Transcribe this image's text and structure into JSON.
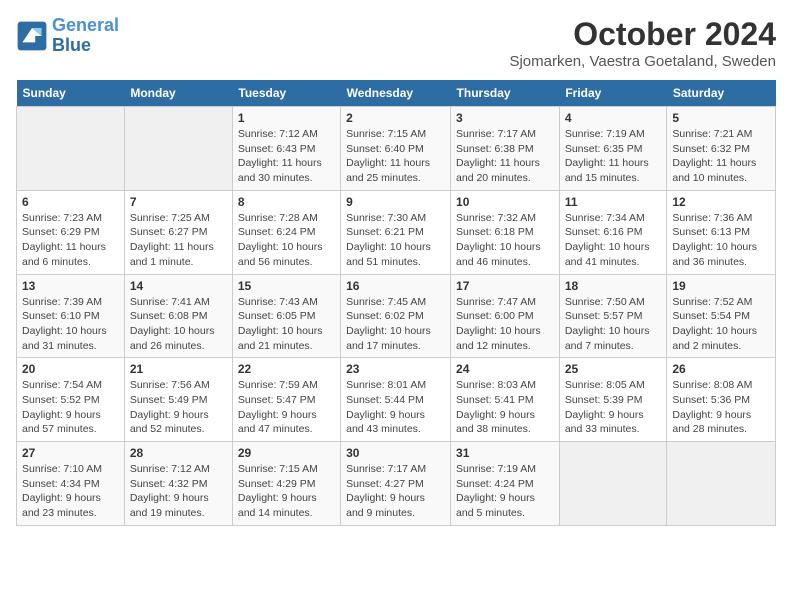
{
  "header": {
    "logo_text_general": "General",
    "logo_text_blue": "Blue",
    "title": "October 2024",
    "subtitle": "Sjomarken, Vaestra Goetaland, Sweden"
  },
  "weekdays": [
    "Sunday",
    "Monday",
    "Tuesday",
    "Wednesday",
    "Thursday",
    "Friday",
    "Saturday"
  ],
  "weeks": [
    [
      {
        "day": "",
        "info": ""
      },
      {
        "day": "",
        "info": ""
      },
      {
        "day": "1",
        "info": "Sunrise: 7:12 AM\nSunset: 6:43 PM\nDaylight: 11 hours\nand 30 minutes."
      },
      {
        "day": "2",
        "info": "Sunrise: 7:15 AM\nSunset: 6:40 PM\nDaylight: 11 hours\nand 25 minutes."
      },
      {
        "day": "3",
        "info": "Sunrise: 7:17 AM\nSunset: 6:38 PM\nDaylight: 11 hours\nand 20 minutes."
      },
      {
        "day": "4",
        "info": "Sunrise: 7:19 AM\nSunset: 6:35 PM\nDaylight: 11 hours\nand 15 minutes."
      },
      {
        "day": "5",
        "info": "Sunrise: 7:21 AM\nSunset: 6:32 PM\nDaylight: 11 hours\nand 10 minutes."
      }
    ],
    [
      {
        "day": "6",
        "info": "Sunrise: 7:23 AM\nSunset: 6:29 PM\nDaylight: 11 hours\nand 6 minutes."
      },
      {
        "day": "7",
        "info": "Sunrise: 7:25 AM\nSunset: 6:27 PM\nDaylight: 11 hours\nand 1 minute."
      },
      {
        "day": "8",
        "info": "Sunrise: 7:28 AM\nSunset: 6:24 PM\nDaylight: 10 hours\nand 56 minutes."
      },
      {
        "day": "9",
        "info": "Sunrise: 7:30 AM\nSunset: 6:21 PM\nDaylight: 10 hours\nand 51 minutes."
      },
      {
        "day": "10",
        "info": "Sunrise: 7:32 AM\nSunset: 6:18 PM\nDaylight: 10 hours\nand 46 minutes."
      },
      {
        "day": "11",
        "info": "Sunrise: 7:34 AM\nSunset: 6:16 PM\nDaylight: 10 hours\nand 41 minutes."
      },
      {
        "day": "12",
        "info": "Sunrise: 7:36 AM\nSunset: 6:13 PM\nDaylight: 10 hours\nand 36 minutes."
      }
    ],
    [
      {
        "day": "13",
        "info": "Sunrise: 7:39 AM\nSunset: 6:10 PM\nDaylight: 10 hours\nand 31 minutes."
      },
      {
        "day": "14",
        "info": "Sunrise: 7:41 AM\nSunset: 6:08 PM\nDaylight: 10 hours\nand 26 minutes."
      },
      {
        "day": "15",
        "info": "Sunrise: 7:43 AM\nSunset: 6:05 PM\nDaylight: 10 hours\nand 21 minutes."
      },
      {
        "day": "16",
        "info": "Sunrise: 7:45 AM\nSunset: 6:02 PM\nDaylight: 10 hours\nand 17 minutes."
      },
      {
        "day": "17",
        "info": "Sunrise: 7:47 AM\nSunset: 6:00 PM\nDaylight: 10 hours\nand 12 minutes."
      },
      {
        "day": "18",
        "info": "Sunrise: 7:50 AM\nSunset: 5:57 PM\nDaylight: 10 hours\nand 7 minutes."
      },
      {
        "day": "19",
        "info": "Sunrise: 7:52 AM\nSunset: 5:54 PM\nDaylight: 10 hours\nand 2 minutes."
      }
    ],
    [
      {
        "day": "20",
        "info": "Sunrise: 7:54 AM\nSunset: 5:52 PM\nDaylight: 9 hours\nand 57 minutes."
      },
      {
        "day": "21",
        "info": "Sunrise: 7:56 AM\nSunset: 5:49 PM\nDaylight: 9 hours\nand 52 minutes."
      },
      {
        "day": "22",
        "info": "Sunrise: 7:59 AM\nSunset: 5:47 PM\nDaylight: 9 hours\nand 47 minutes."
      },
      {
        "day": "23",
        "info": "Sunrise: 8:01 AM\nSunset: 5:44 PM\nDaylight: 9 hours\nand 43 minutes."
      },
      {
        "day": "24",
        "info": "Sunrise: 8:03 AM\nSunset: 5:41 PM\nDaylight: 9 hours\nand 38 minutes."
      },
      {
        "day": "25",
        "info": "Sunrise: 8:05 AM\nSunset: 5:39 PM\nDaylight: 9 hours\nand 33 minutes."
      },
      {
        "day": "26",
        "info": "Sunrise: 8:08 AM\nSunset: 5:36 PM\nDaylight: 9 hours\nand 28 minutes."
      }
    ],
    [
      {
        "day": "27",
        "info": "Sunrise: 7:10 AM\nSunset: 4:34 PM\nDaylight: 9 hours\nand 23 minutes."
      },
      {
        "day": "28",
        "info": "Sunrise: 7:12 AM\nSunset: 4:32 PM\nDaylight: 9 hours\nand 19 minutes."
      },
      {
        "day": "29",
        "info": "Sunrise: 7:15 AM\nSunset: 4:29 PM\nDaylight: 9 hours\nand 14 minutes."
      },
      {
        "day": "30",
        "info": "Sunrise: 7:17 AM\nSunset: 4:27 PM\nDaylight: 9 hours\nand 9 minutes."
      },
      {
        "day": "31",
        "info": "Sunrise: 7:19 AM\nSunset: 4:24 PM\nDaylight: 9 hours\nand 5 minutes."
      },
      {
        "day": "",
        "info": ""
      },
      {
        "day": "",
        "info": ""
      }
    ]
  ]
}
